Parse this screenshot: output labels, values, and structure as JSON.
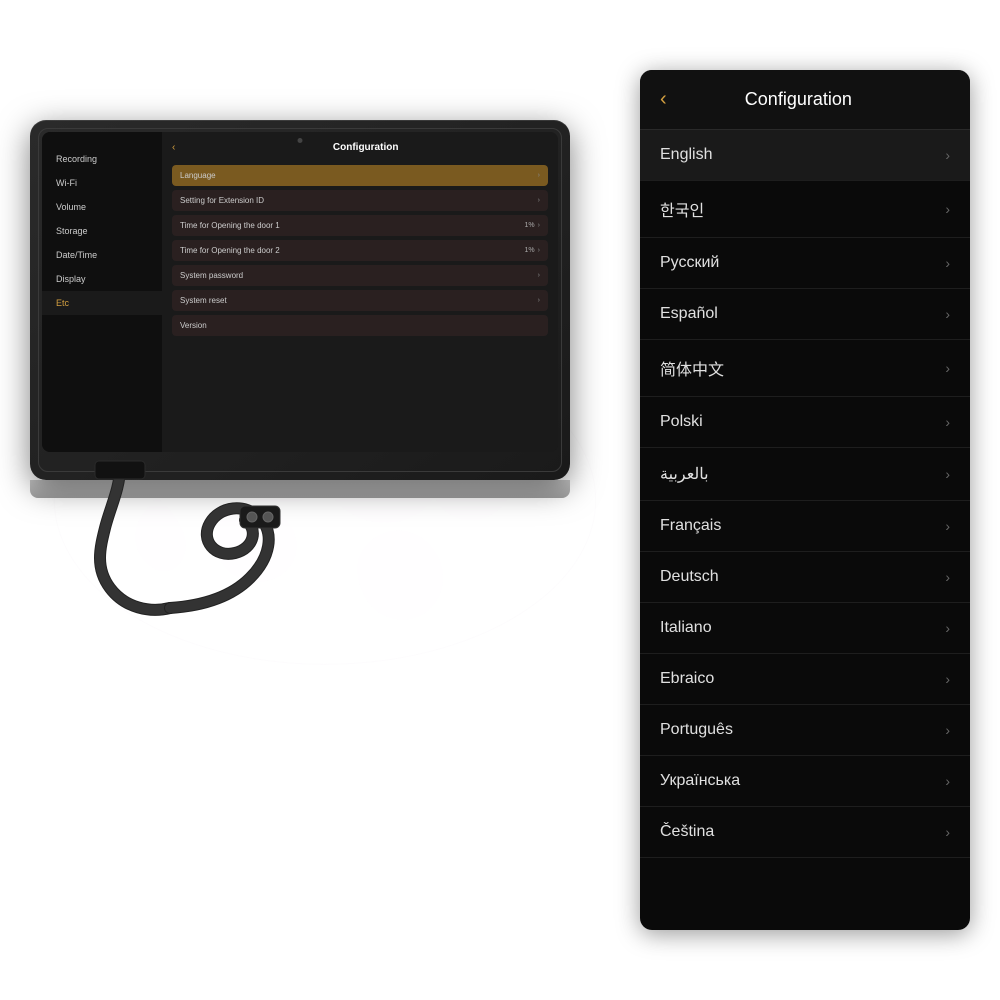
{
  "background": {
    "map_opacity": 0.1
  },
  "device": {
    "camera_visible": true,
    "screen": {
      "sidebar_items": [
        {
          "label": "Recording",
          "active": false
        },
        {
          "label": "Wi-Fi",
          "active": false
        },
        {
          "label": "Volume",
          "active": false
        },
        {
          "label": "Storage",
          "active": false
        },
        {
          "label": "Date/Time",
          "active": false
        },
        {
          "label": "Display",
          "active": false
        },
        {
          "label": "Etc",
          "active": true
        }
      ],
      "title": "Configuration",
      "back_icon": "‹",
      "menu_items": [
        {
          "label": "Language",
          "value": "",
          "arrow": true,
          "highlighted": true
        },
        {
          "label": "Setting for Extension ID",
          "value": "",
          "arrow": true,
          "highlighted": false
        },
        {
          "label": "Time for Opening the door 1",
          "value": "1%",
          "arrow": true,
          "highlighted": false
        },
        {
          "label": "Time for Opening the door 2",
          "value": "1%",
          "arrow": true,
          "highlighted": false
        },
        {
          "label": "System password",
          "value": "",
          "arrow": true,
          "highlighted": false
        },
        {
          "label": "System reset",
          "value": "",
          "arrow": true,
          "highlighted": false
        },
        {
          "label": "Version",
          "value": "",
          "arrow": false,
          "highlighted": false
        }
      ]
    }
  },
  "phone_panel": {
    "header": {
      "back_icon": "‹",
      "title": "Configuration"
    },
    "languages": [
      {
        "label": "English",
        "selected": true
      },
      {
        "label": "한국인",
        "selected": false
      },
      {
        "label": "Русский",
        "selected": false
      },
      {
        "label": "Español",
        "selected": false
      },
      {
        "label": "简体中文",
        "selected": false
      },
      {
        "label": "Polski",
        "selected": false
      },
      {
        "label": "بالعربية",
        "selected": false,
        "rtl": true
      },
      {
        "label": "Français",
        "selected": false
      },
      {
        "label": "Deutsch",
        "selected": false
      },
      {
        "label": "Italiano",
        "selected": false
      },
      {
        "label": "Ebraico",
        "selected": false
      },
      {
        "label": "Português",
        "selected": false
      },
      {
        "label": "Українська",
        "selected": false
      },
      {
        "label": "Čeština",
        "selected": false
      }
    ],
    "chevron": "›"
  }
}
